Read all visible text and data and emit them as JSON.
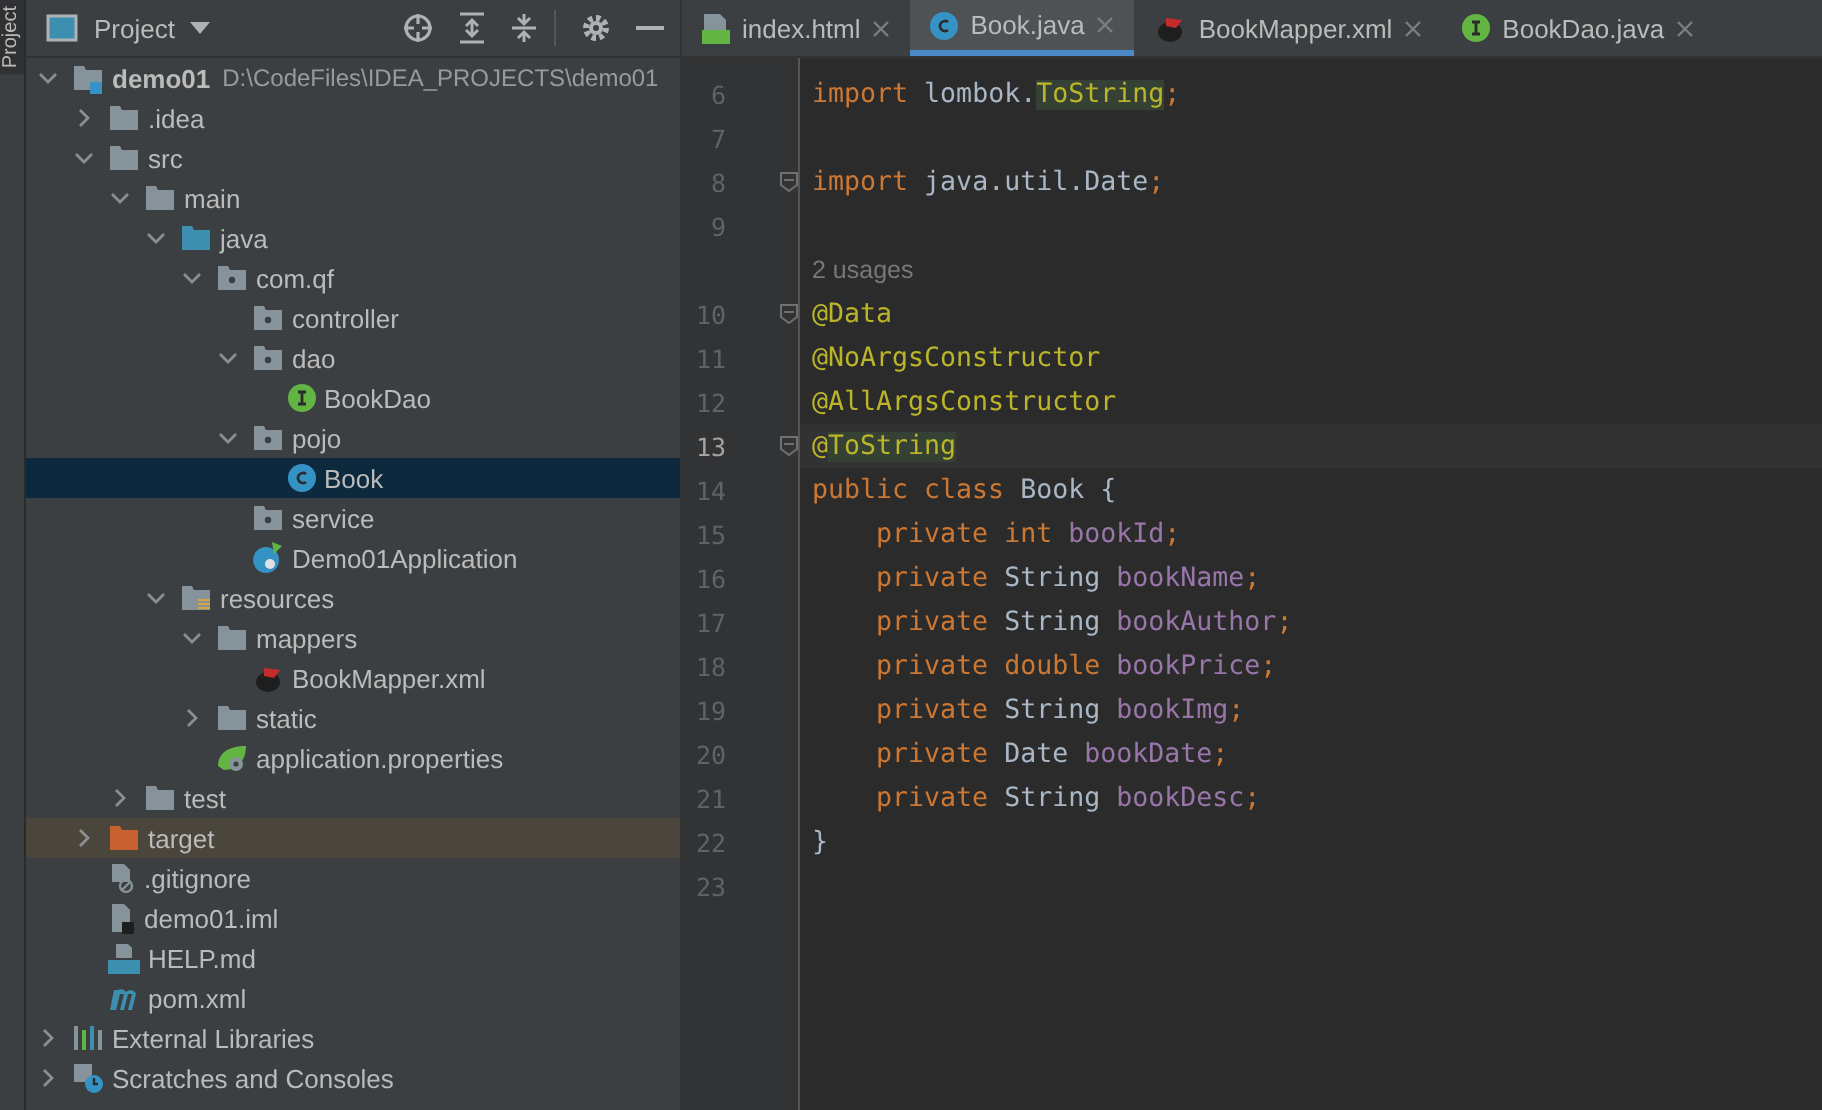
{
  "tool_stripe": {
    "label": "Project"
  },
  "project_panel": {
    "title": "Project"
  },
  "tree": [
    {
      "label": "demo01",
      "kind": "module",
      "bold": true,
      "hint": "D:\\CodeFiles\\IDEA_PROJECTS\\demo01",
      "expanded": true,
      "selected": false,
      "children": [
        {
          "label": ".idea",
          "kind": "folder",
          "expanded": false,
          "selected": false
        },
        {
          "label": "src",
          "kind": "folder",
          "expanded": true,
          "selected": false,
          "children": [
            {
              "label": "main",
              "kind": "folder",
              "expanded": true,
              "selected": false,
              "children": [
                {
                  "label": "java",
                  "kind": "source",
                  "expanded": true,
                  "selected": false,
                  "children": [
                    {
                      "label": "com.qf",
                      "kind": "package",
                      "expanded": true,
                      "selected": false,
                      "children": [
                        {
                          "label": "controller",
                          "kind": "package",
                          "selected": false
                        },
                        {
                          "label": "dao",
                          "kind": "package",
                          "expanded": true,
                          "selected": false,
                          "children": [
                            {
                              "label": "BookDao",
                              "kind": "interface",
                              "selected": false
                            }
                          ]
                        },
                        {
                          "label": "pojo",
                          "kind": "package",
                          "expanded": true,
                          "selected": false,
                          "children": [
                            {
                              "label": "Book",
                              "kind": "class",
                              "selected": true
                            }
                          ]
                        },
                        {
                          "label": "service",
                          "kind": "package",
                          "selected": false
                        },
                        {
                          "label": "Demo01Application",
                          "kind": "spring",
                          "selected": false
                        }
                      ]
                    }
                  ]
                },
                {
                  "label": "resources",
                  "kind": "resources",
                  "expanded": true,
                  "selected": false,
                  "children": [
                    {
                      "label": "mappers",
                      "kind": "folder",
                      "expanded": true,
                      "selected": false,
                      "children": [
                        {
                          "label": "BookMapper.xml",
                          "kind": "mybatis",
                          "selected": false
                        }
                      ]
                    },
                    {
                      "label": "static",
                      "kind": "folder",
                      "expanded": false,
                      "selected": false
                    },
                    {
                      "label": "application.properties",
                      "kind": "properties",
                      "selected": false
                    }
                  ]
                }
              ]
            },
            {
              "label": "test",
              "kind": "folder",
              "expanded": false,
              "selected": false
            }
          ]
        },
        {
          "label": "target",
          "kind": "excluded",
          "expanded": false,
          "selected": false
        },
        {
          "label": ".gitignore",
          "kind": "ignore",
          "selected": false
        },
        {
          "label": "demo01.iml",
          "kind": "iml",
          "selected": false
        },
        {
          "label": "HELP.md",
          "kind": "markdown",
          "selected": false
        },
        {
          "label": "pom.xml",
          "kind": "maven",
          "selected": false
        }
      ]
    },
    {
      "label": "External Libraries",
      "kind": "libraries",
      "expanded": false,
      "selected": false
    },
    {
      "label": "Scratches and Consoles",
      "kind": "scratches",
      "expanded": false,
      "selected": false
    }
  ],
  "tabs": [
    {
      "label": "index.html",
      "kind": "html",
      "selected": false
    },
    {
      "label": "Book.java",
      "kind": "class",
      "selected": true
    },
    {
      "label": "BookMapper.xml",
      "kind": "mybatis",
      "selected": false
    },
    {
      "label": "BookDao.java",
      "kind": "interface",
      "selected": false
    }
  ],
  "code_lines": [
    {
      "number": "6",
      "current": false,
      "fold": false,
      "tokens": [
        {
          "text": "import ",
          "kind": "keyword"
        },
        {
          "text": "lombok.",
          "kind": "plain"
        },
        {
          "text": "ToString",
          "kind": "annotation",
          "highlighted": true
        },
        {
          "text": ";",
          "kind": "keyword"
        }
      ]
    },
    {
      "number": "7",
      "current": false,
      "fold": false
    },
    {
      "number": "8",
      "current": false,
      "fold": true,
      "tokens": [
        {
          "text": "import ",
          "kind": "keyword"
        },
        {
          "text": "java.util.Date",
          "kind": "plain"
        },
        {
          "text": ";",
          "kind": "keyword"
        }
      ]
    },
    {
      "number": "9",
      "current": false,
      "fold": false
    },
    {
      "kind": "usages",
      "text": "2 usages"
    },
    {
      "number": "10",
      "current": false,
      "fold": true,
      "tokens": [
        {
          "text": "@Data",
          "kind": "annotation"
        }
      ]
    },
    {
      "number": "11",
      "current": false,
      "fold": false,
      "tokens": [
        {
          "text": "@NoArgsConstructor",
          "kind": "annotation"
        }
      ]
    },
    {
      "number": "12",
      "current": false,
      "fold": false,
      "tokens": [
        {
          "text": "@AllArgsConstructor",
          "kind": "annotation"
        }
      ]
    },
    {
      "number": "13",
      "current": true,
      "fold": true,
      "tokens": [
        {
          "text": "@",
          "kind": "annotation"
        },
        {
          "text": "ToString",
          "kind": "annotation",
          "highlighted": true
        }
      ]
    },
    {
      "number": "14",
      "current": false,
      "fold": false,
      "tokens": [
        {
          "text": "public class ",
          "kind": "keyword"
        },
        {
          "text": "Book {",
          "kind": "plain"
        }
      ]
    },
    {
      "number": "15",
      "current": false,
      "fold": false,
      "tokens": [
        {
          "text": "    private int ",
          "kind": "keyword"
        },
        {
          "text": "bookId",
          "kind": "field"
        },
        {
          "text": ";",
          "kind": "keyword"
        }
      ]
    },
    {
      "number": "16",
      "current": false,
      "fold": false,
      "tokens": [
        {
          "text": "    private ",
          "kind": "keyword"
        },
        {
          "text": "String ",
          "kind": "plain"
        },
        {
          "text": "bookName",
          "kind": "field"
        },
        {
          "text": ";",
          "kind": "keyword"
        }
      ]
    },
    {
      "number": "17",
      "current": false,
      "fold": false,
      "tokens": [
        {
          "text": "    private ",
          "kind": "keyword"
        },
        {
          "text": "String ",
          "kind": "plain"
        },
        {
          "text": "bookAuthor",
          "kind": "field"
        },
        {
          "text": ";",
          "kind": "keyword"
        }
      ]
    },
    {
      "number": "18",
      "current": false,
      "fold": false,
      "tokens": [
        {
          "text": "    private double ",
          "kind": "keyword"
        },
        {
          "text": "bookPrice",
          "kind": "field"
        },
        {
          "text": ";",
          "kind": "keyword"
        }
      ]
    },
    {
      "number": "19",
      "current": false,
      "fold": false,
      "tokens": [
        {
          "text": "    private ",
          "kind": "keyword"
        },
        {
          "text": "String ",
          "kind": "plain"
        },
        {
          "text": "bookImg",
          "kind": "field"
        },
        {
          "text": ";",
          "kind": "keyword"
        }
      ]
    },
    {
      "number": "20",
      "current": false,
      "fold": false,
      "tokens": [
        {
          "text": "    private ",
          "kind": "keyword"
        },
        {
          "text": "Date ",
          "kind": "plain"
        },
        {
          "text": "bookDate",
          "kind": "field"
        },
        {
          "text": ";",
          "kind": "keyword"
        }
      ]
    },
    {
      "number": "21",
      "current": false,
      "fold": false,
      "tokens": [
        {
          "text": "    private ",
          "kind": "keyword"
        },
        {
          "text": "String ",
          "kind": "plain"
        },
        {
          "text": "bookDesc",
          "kind": "field"
        },
        {
          "text": ";",
          "kind": "keyword"
        }
      ]
    },
    {
      "number": "22",
      "current": false,
      "fold": false,
      "tokens": [
        {
          "text": "}",
          "kind": "plain"
        }
      ]
    },
    {
      "number": "23",
      "current": false,
      "fold": false
    }
  ]
}
